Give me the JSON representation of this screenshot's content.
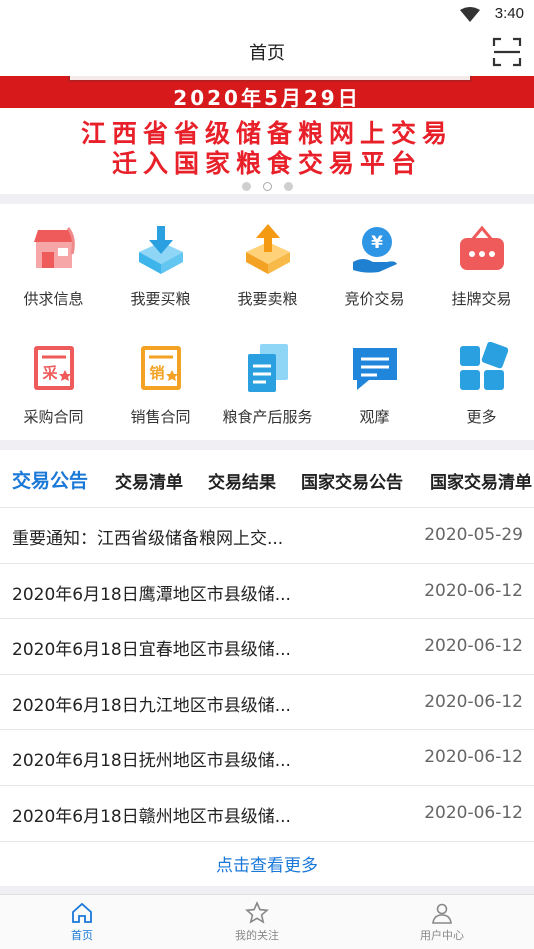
{
  "status_bar": {
    "time": "3:40"
  },
  "header": {
    "title": "首页"
  },
  "banner": {
    "date": "2020年5月29日",
    "line1": "江西省省级储备粮网上交易",
    "line2": "迁入国家粮食交易平台"
  },
  "grid": {
    "items": [
      {
        "label": "供求信息",
        "icon": "store-icon"
      },
      {
        "label": "我要买粮",
        "icon": "download-box-icon"
      },
      {
        "label": "我要卖粮",
        "icon": "upload-box-icon"
      },
      {
        "label": "竞价交易",
        "icon": "yuan-hand-icon"
      },
      {
        "label": "挂牌交易",
        "icon": "hanging-sign-icon"
      },
      {
        "label": "采购合同",
        "icon": "purchase-contract-icon",
        "stamp": "采"
      },
      {
        "label": "销售合同",
        "icon": "sales-contract-icon",
        "stamp": "销"
      },
      {
        "label": "粮食产后服务",
        "icon": "documents-icon"
      },
      {
        "label": "观摩",
        "icon": "chat-bubble-icon"
      },
      {
        "label": "更多",
        "icon": "more-tiles-icon"
      }
    ]
  },
  "tabs": [
    {
      "label": "交易公告",
      "active": true
    },
    {
      "label": "交易清单"
    },
    {
      "label": "交易结果"
    },
    {
      "label": "国家交易公告"
    },
    {
      "label": "国家交易清单"
    }
  ],
  "notices": [
    {
      "title": "重要通知：江西省级储备粮网上交...",
      "date": "2020-05-29"
    },
    {
      "title": "2020年6月18日鹰潭地区市县级储...",
      "date": "2020-06-12"
    },
    {
      "title": "2020年6月18日宜春地区市县级储...",
      "date": "2020-06-12"
    },
    {
      "title": "2020年6月18日九江地区市县级储...",
      "date": "2020-06-12"
    },
    {
      "title": "2020年6月18日抚州地区市县级储...",
      "date": "2020-06-12"
    },
    {
      "title": "2020年6月18日赣州地区市县级储...",
      "date": "2020-06-12"
    }
  ],
  "more_label": "点击查看更多",
  "bottom_nav": [
    {
      "label": "首页",
      "icon": "home-icon",
      "active": true
    },
    {
      "label": "我的关注",
      "icon": "star-icon"
    },
    {
      "label": "用户中心",
      "icon": "user-icon"
    }
  ],
  "colors": {
    "accent": "#1a78d8",
    "banner_red": "#e8202a"
  }
}
